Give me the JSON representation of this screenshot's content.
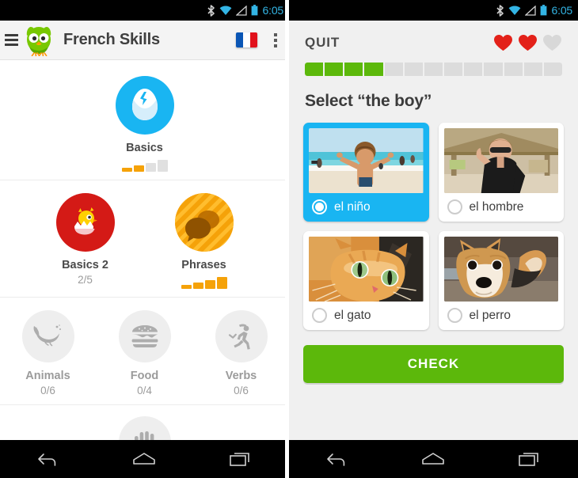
{
  "status_bar": {
    "time": "6:05",
    "icons": [
      "bluetooth-icon",
      "wifi-icon",
      "signal-icon",
      "battery-icon"
    ],
    "time_color": "#33b5e5",
    "background": "#000000"
  },
  "left_screen": {
    "action_bar": {
      "menu_icon": "hamburger-menu-icon",
      "logo_icon": "duolingo-owl-logo",
      "title": "French Skills",
      "flag_icon": "french-flag-icon",
      "overflow_icon": "overflow-menu-icon"
    },
    "skill_tree": {
      "rows": [
        {
          "skills": [
            {
              "name": "Basics",
              "icon": "egg-icon",
              "color": "#19b5f2",
              "state": "unlocked",
              "progress_bars": [
                true,
                true,
                false,
                false
              ],
              "sub": ""
            }
          ]
        },
        {
          "skills": [
            {
              "name": "Basics 2",
              "icon": "hatching-chick-icon",
              "color": "#d41a16",
              "state": "unlocked",
              "sub": "2/5",
              "progress_bars": []
            },
            {
              "name": "Phrases",
              "icon": "speech-bubbles-icon",
              "color": "#f5a209",
              "state": "unlocked",
              "sub": "",
              "progress_bars": [
                true,
                true,
                true,
                true
              ]
            }
          ]
        },
        {
          "skills": [
            {
              "name": "Animals",
              "icon": "whale-icon",
              "color": "#eeeeee",
              "state": "locked",
              "sub": "0/6",
              "progress_bars": []
            },
            {
              "name": "Food",
              "icon": "hamburger-food-icon",
              "color": "#eeeeee",
              "state": "locked",
              "sub": "0/4",
              "progress_bars": []
            },
            {
              "name": "Verbs",
              "icon": "running-person-icon",
              "color": "#eeeeee",
              "state": "locked",
              "sub": "0/6",
              "progress_bars": []
            }
          ]
        }
      ],
      "partial_skill": {
        "icon": "hand-icon",
        "color": "#eeeeee",
        "state": "locked"
      }
    }
  },
  "right_screen": {
    "quit_label": "QUIT",
    "hearts": {
      "total": 3,
      "filled": 2,
      "filled_color": "#e32119",
      "empty_color": "#d8d8d8"
    },
    "progress": {
      "total_segments": 13,
      "completed_segments": 4,
      "fill_color": "#5cb80b",
      "track_color": "#dcdcdc"
    },
    "prompt": "Select “the boy”",
    "choices": [
      {
        "label": "el niño",
        "image": "boy-on-beach-photo",
        "selected": true
      },
      {
        "label": "el hombre",
        "image": "man-with-sunglasses-photo",
        "selected": false
      },
      {
        "label": "el gato",
        "image": "orange-cat-photo",
        "selected": false
      },
      {
        "label": "el perro",
        "image": "shiba-inu-dog-photo",
        "selected": false
      }
    ],
    "check_label": "CHECK",
    "check_color": "#5cb80b"
  },
  "nav_bar": {
    "buttons": [
      {
        "name": "back-button",
        "icon": "back-arrow-icon"
      },
      {
        "name": "home-button",
        "icon": "home-icon"
      },
      {
        "name": "recents-button",
        "icon": "recents-icon"
      }
    ]
  }
}
